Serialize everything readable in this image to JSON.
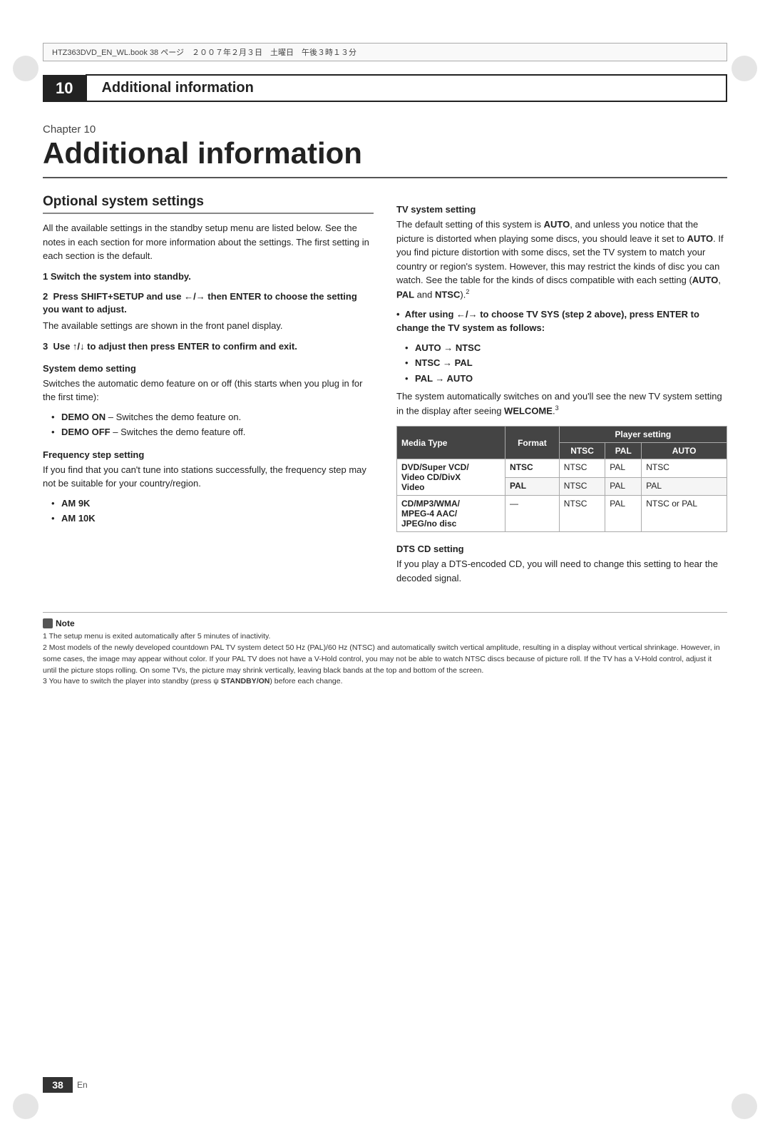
{
  "file_header": {
    "text": "HTZ363DVD_EN_WL.book  38 ページ　２００７年２月３日　土曜日　午後３時１３分"
  },
  "chapter_header": {
    "number": "10",
    "title": "Additional information"
  },
  "chapter_label": "Chapter 10",
  "big_title": "Additional information",
  "left_col": {
    "section_title": "Optional system settings",
    "intro_text": "All the available settings in the standby setup menu are listed below. See the notes in each section for more information about the settings. The first setting in each section is the default.",
    "step1": "1  Switch the system into standby.",
    "step2": "2  Press SHIFT+SETUP and use ←/→ then ENTER to choose the setting you want to adjust.",
    "step2_sub": "The available settings are shown in the front panel display.",
    "step3": "3  Use ↑/↓ to adjust then press ENTER to confirm and exit.",
    "system_demo": {
      "heading": "System demo setting",
      "text": "Switches the automatic demo feature on or off (this starts when you plug in for the first time):",
      "bullets": [
        "DEMO ON – Switches the demo feature on.",
        "DEMO OFF – Switches the demo feature off."
      ]
    },
    "freq_step": {
      "heading": "Frequency step setting",
      "text": "If you find that you can't tune into stations successfully, the frequency step may not be suitable for your country/region.",
      "bullets": [
        "AM 9K",
        "AM 10K"
      ]
    }
  },
  "right_col": {
    "tv_system": {
      "heading": "TV system setting",
      "text1": "The default setting of this system is AUTO, and unless you notice that the picture is distorted when playing some discs, you should leave it set to AUTO. If you find picture distortion with some discs, set the TV system to match your country or region's system. However, this may restrict the kinds of disc you can watch. See the table for the kinds of discs compatible with each setting (AUTO, PAL and NTSC).",
      "footnote_ref": "2",
      "bullet_intro": "After using ←/→ to choose TV SYS (step 2 above), press ENTER to change the TV system as follows:",
      "bullets": [
        "AUTO → NTSC",
        "NTSC → PAL",
        "PAL → AUTO"
      ],
      "after_bullets": "The system automatically switches on and you'll see the new TV system setting in the display after seeing WELCOME.",
      "footnote_ref2": "3"
    },
    "table": {
      "header_player": "Player setting",
      "col_headers": [
        "Media Type",
        "Format",
        "NTSC",
        "PAL",
        "AUTO"
      ],
      "rows": [
        {
          "media": "DVD/Super VCD/ Video CD/DivX Video",
          "format1": "NTSC",
          "ntsc1": "NTSC",
          "pal1": "PAL",
          "auto1": "NTSC",
          "format2": "PAL",
          "ntsc2": "NTSC",
          "pal2": "PAL",
          "auto2": "PAL"
        },
        {
          "media": "CD/MP3/WMA/ MPEG-4 AAC/ JPEG/no disc",
          "format": "—",
          "ntsc": "NTSC",
          "pal": "PAL",
          "auto": "NTSC or PAL"
        }
      ]
    },
    "dts_cd": {
      "heading": "DTS CD setting",
      "text": "If you play a DTS-encoded CD, you will need to change this setting to hear the decoded signal."
    }
  },
  "note": {
    "title": "Note",
    "lines": [
      "1  The setup menu is exited automatically after 5 minutes of inactivity.",
      "2  Most models of the newly developed countdown PAL TV system detect 50 Hz (PAL)/60 Hz (NTSC) and automatically switch vertical amplitude, resulting in a display without vertical shrinkage. However, in some cases, the image may appear without color. If your PAL TV does not have a V-Hold control, you may not be able to watch NTSC discs because of picture roll. If the TV has a V-Hold control, adjust it until the picture stops rolling. On some TVs, the picture may shrink vertically, leaving black bands at the top and bottom of the screen.",
      "3  You have to switch the player into standby (press ψ STANDBY/ON) before each change."
    ]
  },
  "footer": {
    "page_number": "38",
    "language": "En"
  }
}
